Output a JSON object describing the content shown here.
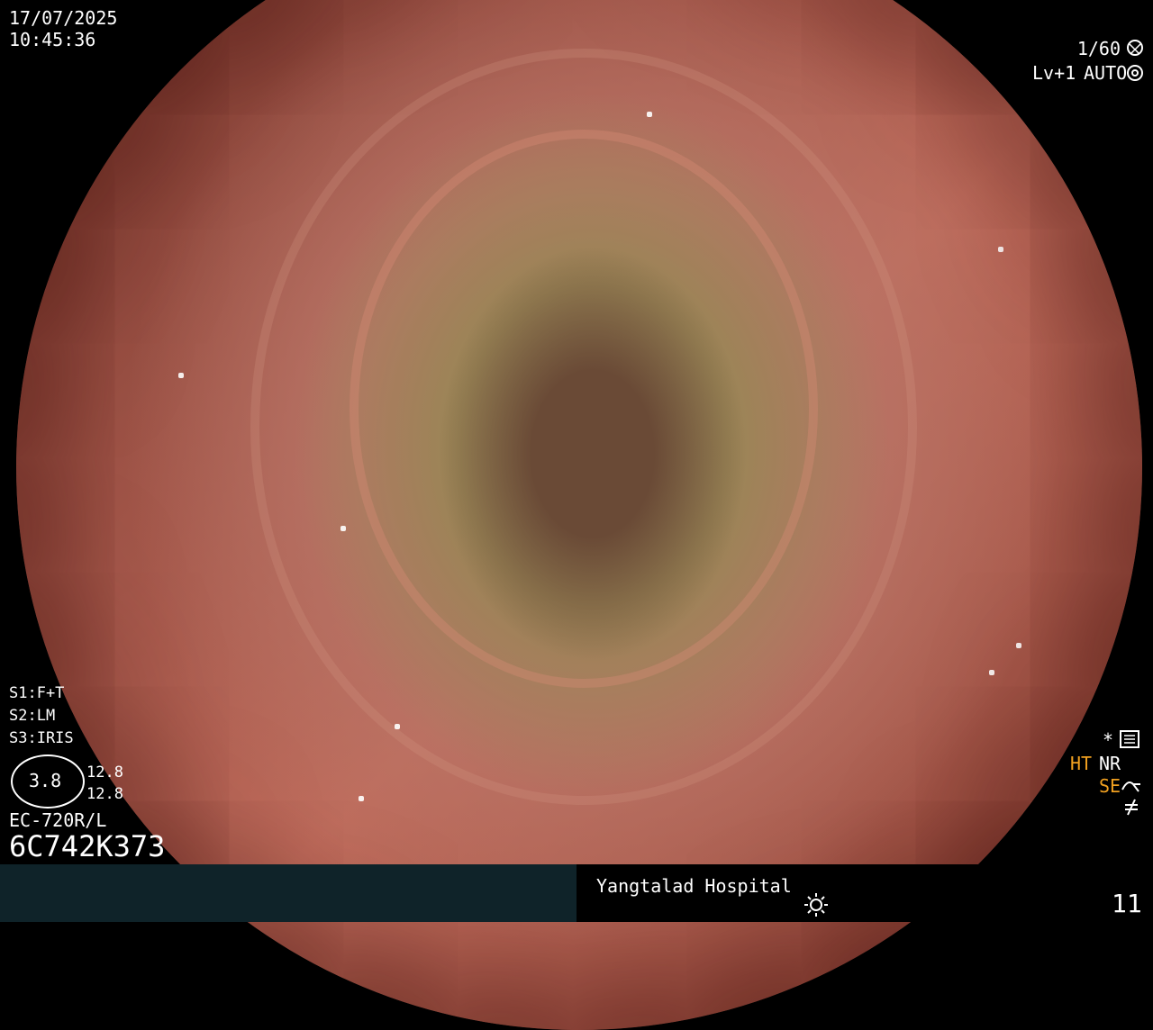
{
  "datetime": {
    "date": "17/07/2025",
    "time": "10:45:36"
  },
  "top_right": {
    "shutter": "1/60",
    "level": "Lv+1",
    "mode": "AUTO"
  },
  "settings": {
    "s1": "S1:F+T",
    "s2": "S2:LM",
    "s3": "S3:IRIS"
  },
  "gauge": {
    "value": "3.8",
    "upper": "12.8",
    "lower": "12.8"
  },
  "scope_model": "EC-720R/L",
  "serial": "6C742K373",
  "right_status": {
    "star": "*",
    "ht": "HT",
    "nr": "NR",
    "se": "SE",
    "icons": [
      "settings-sliders-icon",
      "curve-icon",
      "not-equal-icon"
    ]
  },
  "footer": {
    "hospital": "Yangtalad Hospital",
    "number": "11",
    "icon": "light-sun-icon"
  }
}
